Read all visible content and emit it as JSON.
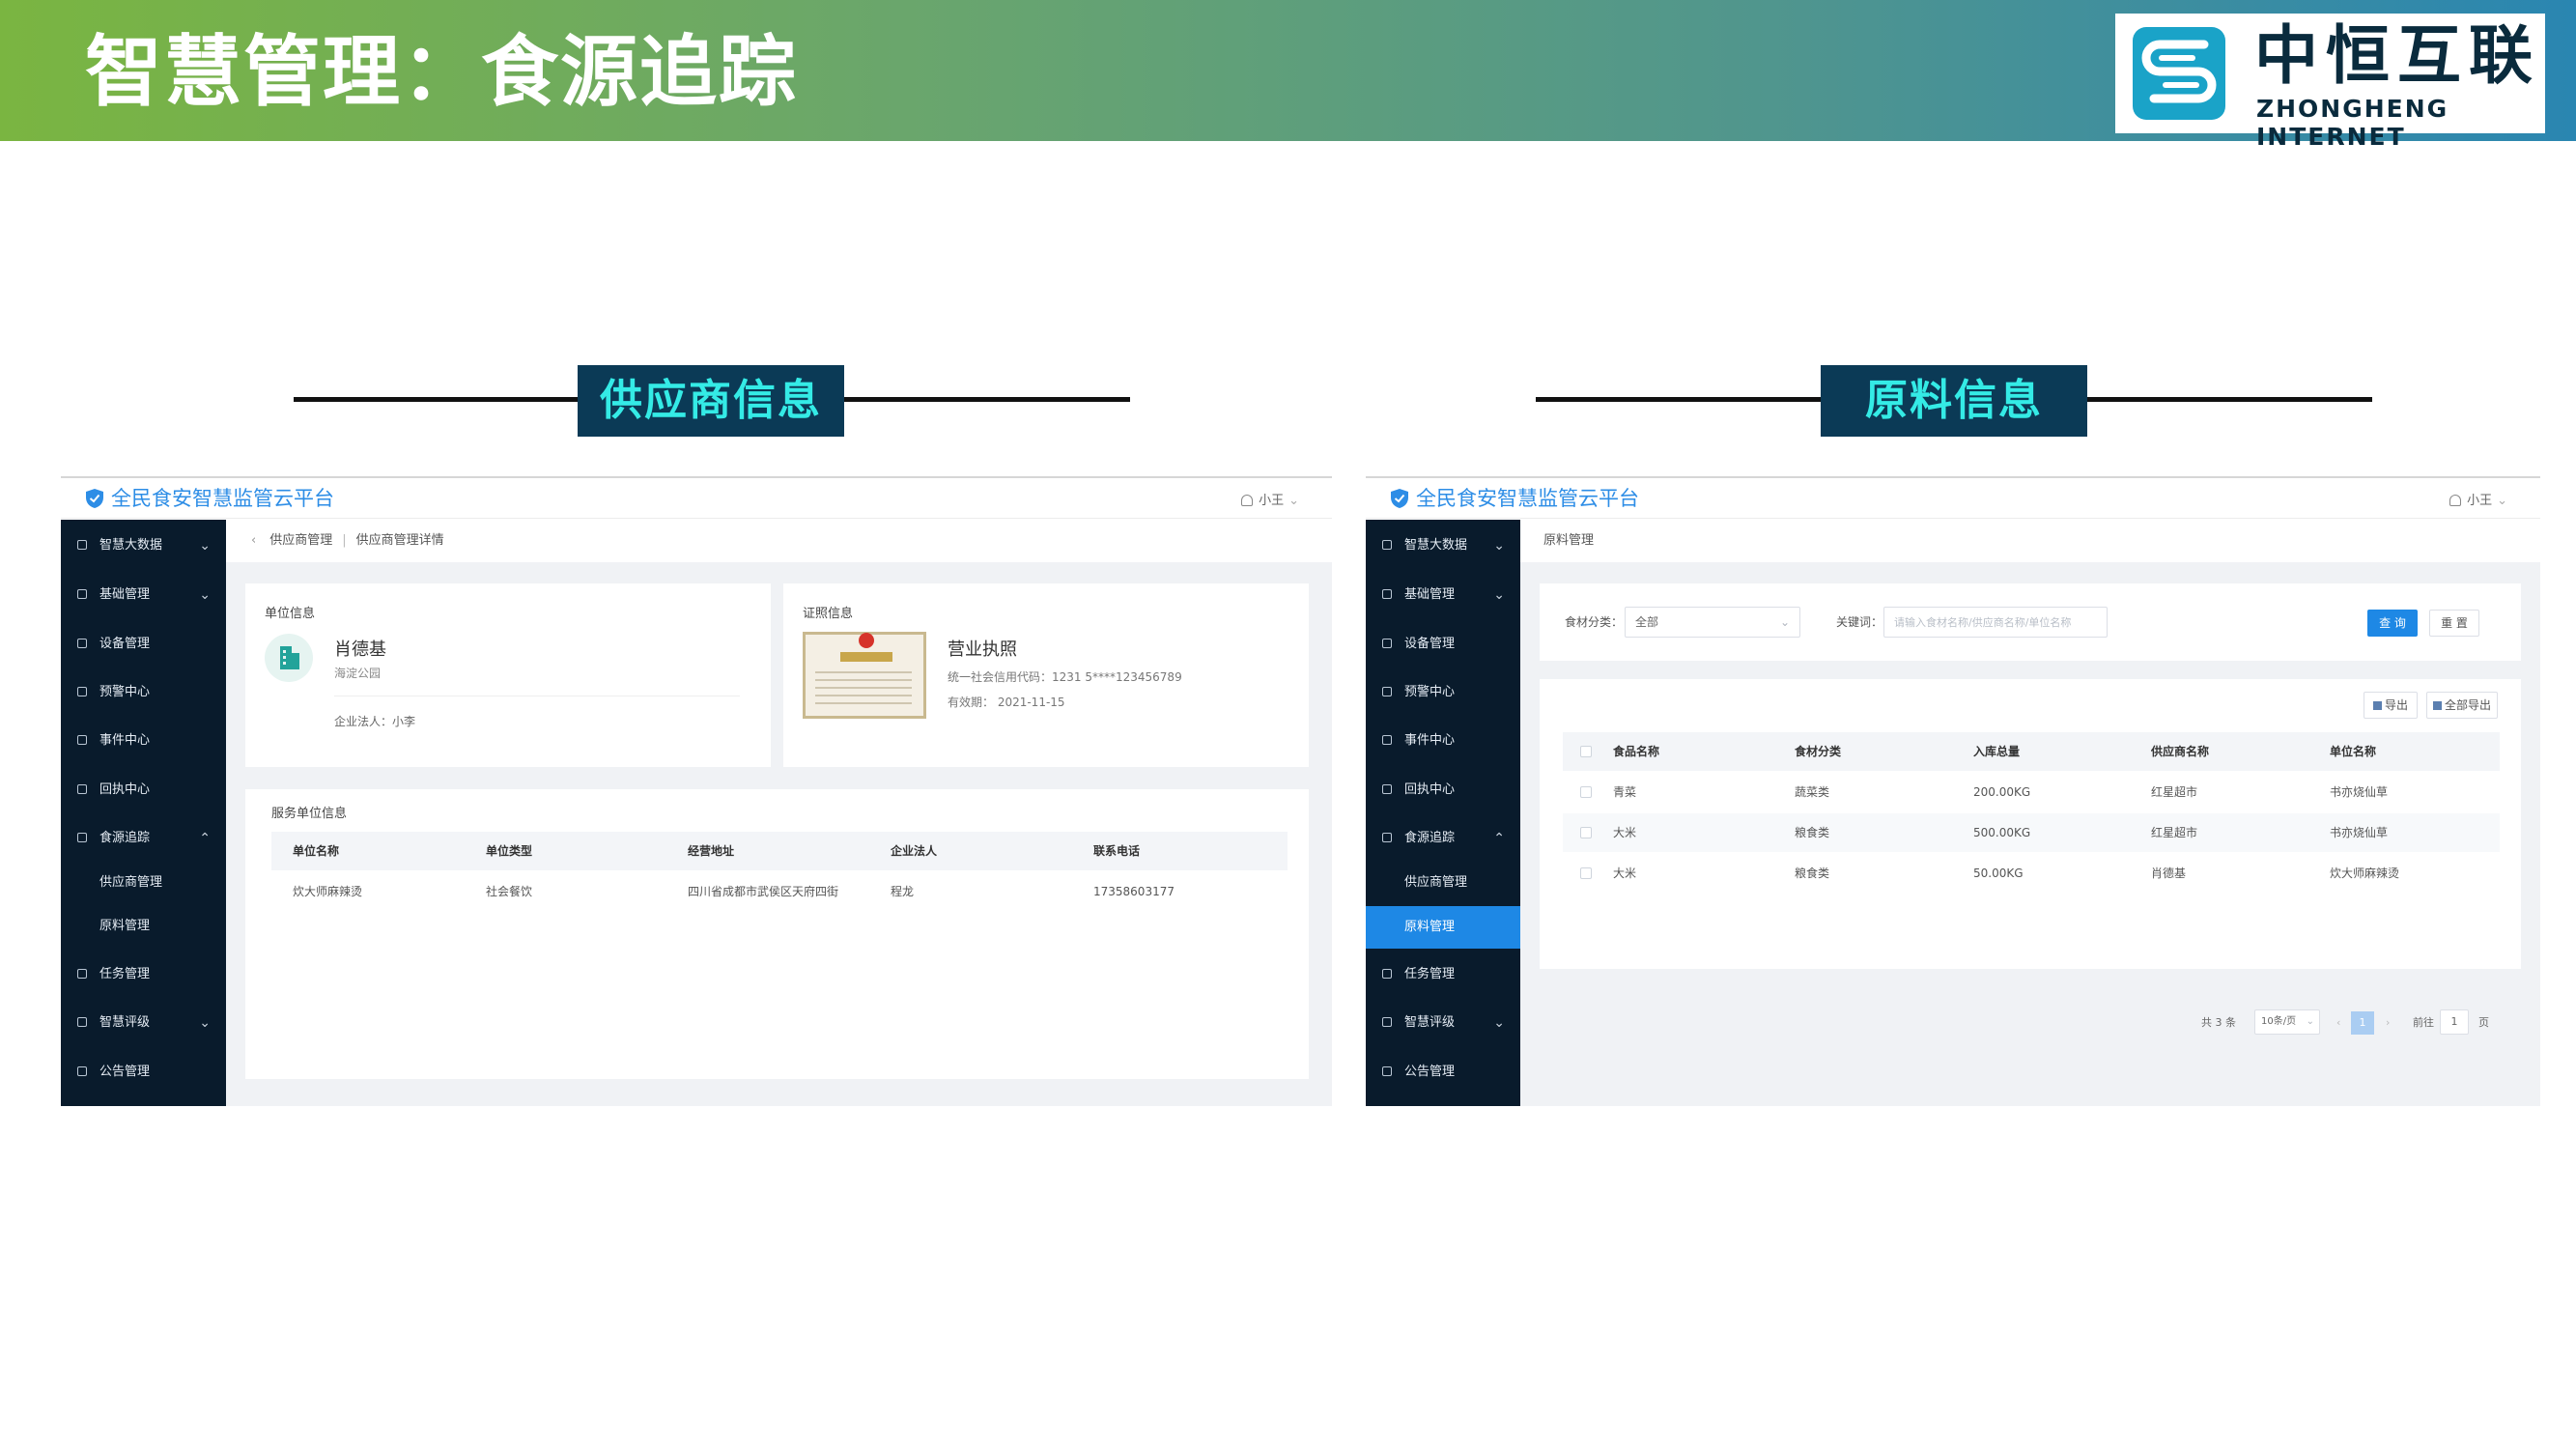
{
  "banner": {
    "title": "智慧管理：食源追踪"
  },
  "logo": {
    "cn": "中恒互联",
    "en": "ZHONGHENG INTERNET"
  },
  "sections": {
    "left": "供应商信息",
    "right": "原料信息"
  },
  "app": {
    "title": "全民食安智慧监管云平台",
    "user": "小王",
    "menu": [
      "智慧大数据",
      "基础管理",
      "设备管理",
      "预警中心",
      "事件中心",
      "回执中心",
      "食源追踪",
      "任务管理",
      "智慧评级",
      "公告管理"
    ],
    "submenu": [
      "供应商管理",
      "原料管理"
    ]
  },
  "supplier": {
    "breadcrumb": [
      "供应商管理",
      "供应商管理详情"
    ],
    "unit_card_label": "单位信息",
    "unit_name": "肖德基",
    "unit_district": "海淀公园",
    "legal_person": "企业法人：小李",
    "cert_card_label": "证照信息",
    "cert_title": "营业执照",
    "cert_no": "统一社会信用代码：1231 5****123456789",
    "cert_valid": "有效期：  2021-11-15",
    "service_label": "服务单位信息",
    "service_columns": [
      "单位名称",
      "单位类型",
      "经营地址",
      "企业法人",
      "联系电话"
    ],
    "service_rows": [
      [
        "炊大师麻辣烫",
        "社会餐饮",
        "四川省成都市武侯区天府四街",
        "程龙",
        "17358603177"
      ]
    ]
  },
  "material": {
    "breadcrumb": "原料管理",
    "filter_category_label": "食材分类：",
    "filter_category_value": "全部",
    "filter_keyword_label": "关键词：",
    "filter_keyword_placeholder": "请输入食材名称/供应商名称/单位名称",
    "search_button": "查 询",
    "reset_button": "重 置",
    "export_button": "导出",
    "export_all_button": "全部导出",
    "columns": [
      "食品名称",
      "食材分类",
      "入库总量",
      "供应商名称",
      "单位名称"
    ],
    "rows": [
      [
        "青菜",
        "蔬菜类",
        "200.00KG",
        "红星超市",
        "书亦烧仙草"
      ],
      [
        "大米",
        "粮食类",
        "500.00KG",
        "红星超市",
        "书亦烧仙草"
      ],
      [
        "大米",
        "粮食类",
        "50.00KG",
        "肖德基",
        "炊大师麻辣烫"
      ]
    ],
    "pagination": {
      "total": "共 3 条",
      "page_size": "10条/页",
      "current": "1",
      "goto_label": "前往",
      "goto_value": "1",
      "page_unit": "页"
    }
  },
  "colors": {
    "accent": "#1e88e5",
    "sidebar": "#091b2c",
    "tag_bg": "#0b3a56",
    "tag_text": "#34ebe6"
  }
}
